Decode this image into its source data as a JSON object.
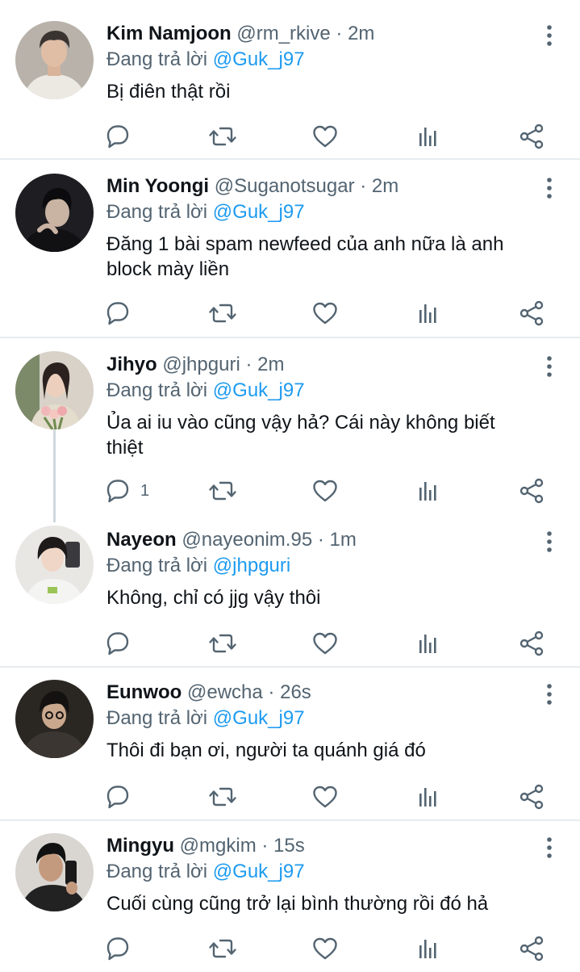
{
  "reply_prefix": "Đang trả lời",
  "tweets": [
    {
      "name": "Kim Namjoon",
      "handle": "@rm_rkive",
      "separator": "·",
      "time": "2m",
      "reply_to": "@Guk_j97",
      "text": "Bị điên thật rồi",
      "reply_count": ""
    },
    {
      "name": "Min Yoongi",
      "handle": "@Suganotsugar",
      "separator": "·",
      "time": "2m",
      "reply_to": "@Guk_j97",
      "text": "Đăng 1 bài spam newfeed của anh nữa là anh block mày liền",
      "reply_count": ""
    },
    {
      "name": "Jihyo",
      "handle": "@jhpguri",
      "separator": "·",
      "time": "2m",
      "reply_to": "@Guk_j97",
      "text": "Ủa ai iu vào cũng vậy hả? Cái này không biết thiệt",
      "reply_count": "1"
    },
    {
      "name": "Nayeon",
      "handle": "@nayeonim.95",
      "separator": "·",
      "time": "1m",
      "reply_to": "@jhpguri",
      "text": "Không, chỉ có jjg vậy thôi",
      "reply_count": ""
    },
    {
      "name": "Eunwoo",
      "handle": "@ewcha",
      "separator": "·",
      "time": "26s",
      "reply_to": "@Guk_j97",
      "text": "Thôi đi bạn ơi, người ta quánh giá đó",
      "reply_count": ""
    },
    {
      "name": "Mingyu",
      "handle": "@mgkim",
      "separator": "·",
      "time": "15s",
      "reply_to": "@Guk_j97",
      "text": "Cuối cùng cũng trở lại bình thường rồi đó hả",
      "reply_count": ""
    }
  ],
  "icons": {
    "more": "more-vertical-icon",
    "reply": "reply-bubble-icon",
    "retweet": "retweet-icon",
    "like": "heart-icon",
    "views": "analytics-bars-icon",
    "share": "share-icon"
  },
  "colors": {
    "text": "#0f1419",
    "secondary": "#536471",
    "link": "#1d9bf0",
    "divider": "#e6ecf0",
    "thread_line": "#cfd9de"
  }
}
